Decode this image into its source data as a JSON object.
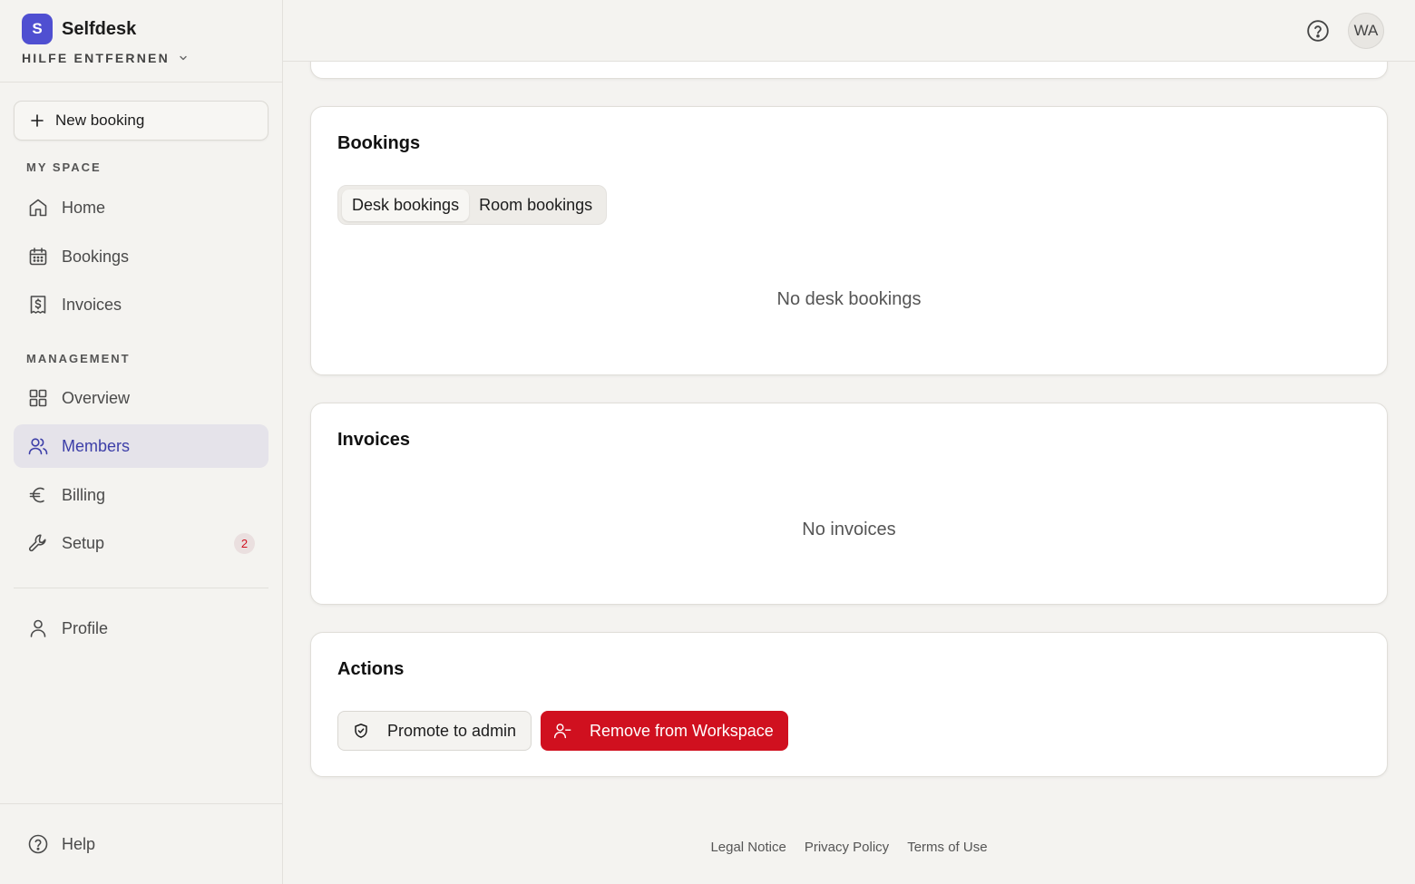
{
  "brand": {
    "logo_letter": "S",
    "name": "Selfdesk",
    "accent": "#4f4fd1"
  },
  "workspace": {
    "name": "HILFE ENTFERNEN"
  },
  "sidebar": {
    "new_booking_label": "New booking",
    "sections": {
      "my_space": "MY SPACE",
      "management": "MANAGEMENT"
    },
    "items": {
      "home": "Home",
      "bookings": "Bookings",
      "invoices": "Invoices",
      "overview": "Overview",
      "members": "Members",
      "billing": "Billing",
      "setup": "Setup",
      "setup_badge": "2",
      "profile": "Profile",
      "help": "Help"
    },
    "active_item": "members"
  },
  "topbar": {
    "avatar_initials": "WA"
  },
  "bookings_card": {
    "title": "Bookings",
    "tabs": [
      "Desk bookings",
      "Room bookings"
    ],
    "active_tab": "Desk bookings",
    "empty_text": "No desk bookings"
  },
  "invoices_card": {
    "title": "Invoices",
    "empty_text": "No invoices"
  },
  "actions_card": {
    "title": "Actions",
    "promote_label": "Promote to admin",
    "remove_label": "Remove from Workspace",
    "danger_color": "#d0101f"
  },
  "footer": {
    "links": [
      "Legal Notice",
      "Privacy Policy",
      "Terms of Use"
    ]
  }
}
